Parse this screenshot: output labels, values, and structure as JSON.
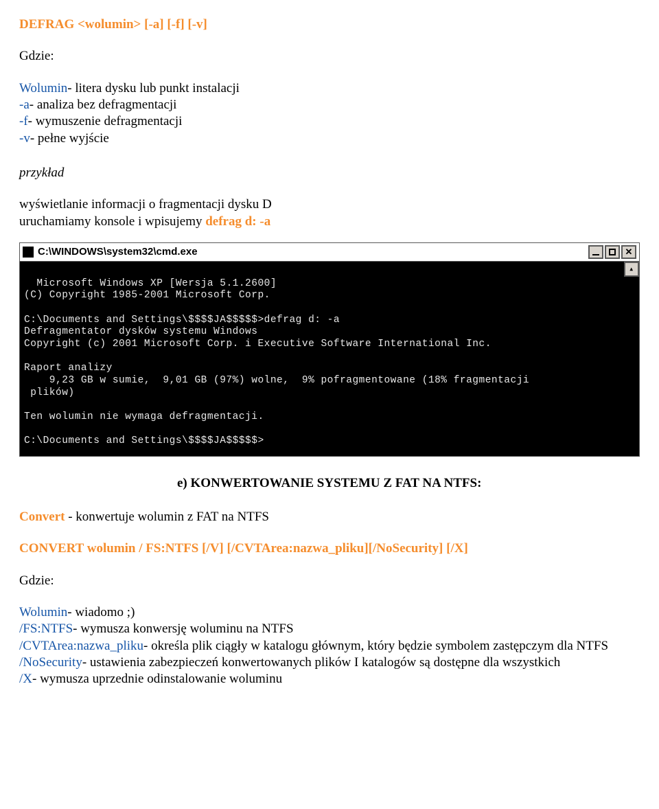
{
  "heading1": "DEFRAG <wolumin> [-a] [-f] [-v]",
  "gdzie": "Gdzie:",
  "defrag_opts": {
    "l1_b": "Wolumin",
    "l1": "- litera dysku lub punkt instalacji",
    "l2_b": "-a",
    "l2": "- analiza bez defragmentacji",
    "l3_b": "-f",
    "l3": "- wymuszenie defragmentacji",
    "l4_b": "-v",
    "l4": "- pełne wyjście"
  },
  "przyklad": "przykład",
  "example": {
    "pre": "wyświetlanie informacji o fragmentacji dysku D",
    "line": "uruchamiamy konsole i wpisujemy ",
    "cmd": "defrag d: -a"
  },
  "titlebar": {
    "path": "C:\\WINDOWS\\system32\\cmd.exe"
  },
  "console": {
    "l1": "Microsoft Windows XP [Wersja 5.1.2600]",
    "l2": "(C) Copyright 1985-2001 Microsoft Corp.",
    "l3": "",
    "l4": "C:\\Documents and Settings\\$$$$JA$$$$$>defrag d: -a",
    "l5": "Defragmentator dysków systemu Windows",
    "l6": "Copyright (c) 2001 Microsoft Corp. i Executive Software International Inc.",
    "l7": "",
    "l8": "Raport analizy",
    "l9": "    9,23 GB w sumie,  9,01 GB (97%) wolne,  9% pofragmentowane (18% fragmentacji",
    "l10": " plików)",
    "l11": "",
    "l12": "Ten wolumin nie wymaga defragmentacji.",
    "l13": "",
    "l14": "C:\\Documents and Settings\\$$$$JA$$$$$>"
  },
  "section_e": "e)  KONWERTOWANIE SYSTEMU Z FAT NA NTFS:",
  "convert_line": {
    "kw": "Convert",
    "rest": " -  konwertuje wolumin z FAT na NTFS"
  },
  "convert_syntax": "CONVERT wolumin / FS:NTFS [/V] [/CVTArea:nazwa_pliku][/NoSecurity] [/X]",
  "opts2": {
    "a_b": "Wolumin",
    "a": "- wiadomo ;)",
    "b_b": "/FS:NTFS",
    "b": "- wymusza konwersję woluminu na NTFS",
    "c_b": "/CVTArea:nazwa_pliku",
    "c": "- określa plik ciągły w katalogu głównym, który będzie symbolem zastępczym dla NTFS",
    "d_b": "/NoSecurity",
    "d": "- ustawienia zabezpieczeń konwertowanych plików I katalogów są dostępne dla wszystkich",
    "e_b": "/X",
    "e": "- wymusza uprzednie odinstalowanie woluminu"
  }
}
